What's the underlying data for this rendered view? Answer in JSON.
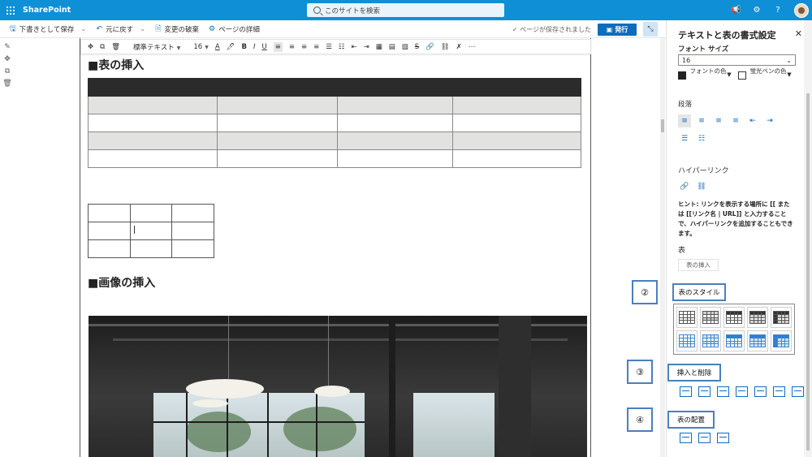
{
  "suitebar": {
    "brand": "SharePoint",
    "search_placeholder": "このサイトを検索"
  },
  "commandbar": {
    "save_draft": "下書きとして保存",
    "undo": "元に戻す",
    "discard": "変更の破棄",
    "page_details": "ページの詳細",
    "saved_status": "ページが保存されました",
    "publish": "発行"
  },
  "format_toolbar": {
    "style_label": "標準テキスト",
    "size_label": "16"
  },
  "canvas": {
    "heading_table": "■表の挿入",
    "heading_image": "■画像の挿入"
  },
  "panel": {
    "title": "テキストと表の書式設定",
    "font_size_label": "フォント サイズ",
    "font_size_value": "16",
    "font_color_label": "フォントの色",
    "highlight_label": "蛍光ペンの色",
    "paragraph_label": "段落",
    "hyperlink_label": "ハイパーリンク",
    "hint_text": "ヒント: リンクを表示する場所に [[ または [[リンク名 | URL]] と入力することで、ハイパーリンクを追加することもできます。",
    "table_label": "表",
    "insert_table_button": "表の挿入",
    "table_style_label": "表のスタイル",
    "insert_delete_label": "挿入と削除",
    "table_alignment_label": "表の配置"
  },
  "callouts": {
    "n2": "②",
    "n3": "③",
    "n4": "④"
  },
  "colors": {
    "suitebar": "#0f8fd6",
    "accent": "#0f6cbd",
    "callout_border": "#4a7fc0"
  }
}
